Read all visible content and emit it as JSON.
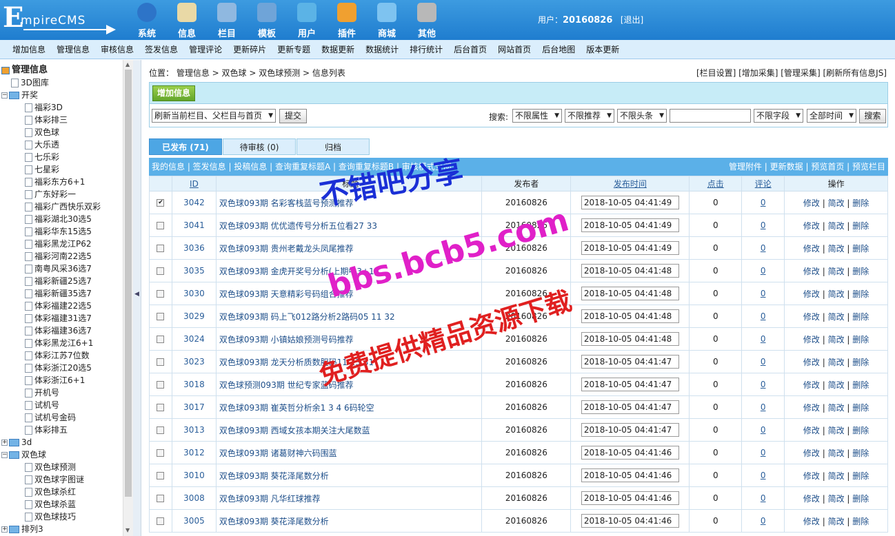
{
  "app": {
    "logo_first": "E",
    "logo_rest": "mpireCMS"
  },
  "mainmenu": [
    {
      "label": "系统",
      "icon": "globe-icon",
      "color": "#2d74c8"
    },
    {
      "label": "信息",
      "icon": "notepad-icon",
      "color": "#e9d9a6"
    },
    {
      "label": "栏目",
      "icon": "folder-icon",
      "color": "#8fb8e0"
    },
    {
      "label": "模板",
      "icon": "window-icon",
      "color": "#6fa4d8"
    },
    {
      "label": "用户",
      "icon": "user-icon",
      "color": "#5bb3e6"
    },
    {
      "label": "插件",
      "icon": "tools-icon",
      "color": "#f0a030"
    },
    {
      "label": "商城",
      "icon": "card-icon",
      "color": "#7ec3f0"
    },
    {
      "label": "其他",
      "icon": "gear-icon",
      "color": "#b8b8b8"
    }
  ],
  "user": {
    "prefix": "用户：",
    "name": "20160826",
    "logout": "[退出]"
  },
  "subnav": [
    "增加信息",
    "管理信息",
    "审核信息",
    "签发信息",
    "管理评论",
    "更新碎片",
    "更新专题",
    "数据更新",
    "数据统计",
    "排行统计",
    "后台首页",
    "网站首页",
    "后台地图",
    "版本更新"
  ],
  "tree": [
    {
      "label": "管理信息",
      "lvl": 0,
      "kind": "root"
    },
    {
      "label": "3D图库",
      "lvl": 1,
      "kind": "page"
    },
    {
      "label": "开奖",
      "lvl": 0,
      "kind": "folder",
      "open": true
    },
    {
      "label": "福彩3D",
      "lvl": 2,
      "kind": "page"
    },
    {
      "label": "体彩排三",
      "lvl": 2,
      "kind": "page"
    },
    {
      "label": "双色球",
      "lvl": 2,
      "kind": "page"
    },
    {
      "label": "大乐透",
      "lvl": 2,
      "kind": "page"
    },
    {
      "label": "七乐彩",
      "lvl": 2,
      "kind": "page"
    },
    {
      "label": "七星彩",
      "lvl": 2,
      "kind": "page"
    },
    {
      "label": "福彩东方6+1",
      "lvl": 2,
      "kind": "page"
    },
    {
      "label": "广东好彩一",
      "lvl": 2,
      "kind": "page"
    },
    {
      "label": "福彩广西快乐双彩",
      "lvl": 2,
      "kind": "page"
    },
    {
      "label": "福彩湖北30选5",
      "lvl": 2,
      "kind": "page"
    },
    {
      "label": "福彩华东15选5",
      "lvl": 2,
      "kind": "page"
    },
    {
      "label": "福彩黑龙江P62",
      "lvl": 2,
      "kind": "page"
    },
    {
      "label": "福彩河南22选5",
      "lvl": 2,
      "kind": "page"
    },
    {
      "label": "南粤风采36选7",
      "lvl": 2,
      "kind": "page"
    },
    {
      "label": "福彩新疆25选7",
      "lvl": 2,
      "kind": "page"
    },
    {
      "label": "福彩新疆35选7",
      "lvl": 2,
      "kind": "page"
    },
    {
      "label": "体彩福建22选5",
      "lvl": 2,
      "kind": "page"
    },
    {
      "label": "体彩福建31选7",
      "lvl": 2,
      "kind": "page"
    },
    {
      "label": "体彩福建36选7",
      "lvl": 2,
      "kind": "page"
    },
    {
      "label": "体彩黑龙江6+1",
      "lvl": 2,
      "kind": "page"
    },
    {
      "label": "体彩江苏7位数",
      "lvl": 2,
      "kind": "page"
    },
    {
      "label": "体彩浙江20选5",
      "lvl": 2,
      "kind": "page"
    },
    {
      "label": "体彩浙江6+1",
      "lvl": 2,
      "kind": "page"
    },
    {
      "label": "开机号",
      "lvl": 2,
      "kind": "page"
    },
    {
      "label": "试机号",
      "lvl": 2,
      "kind": "page"
    },
    {
      "label": "试机号金码",
      "lvl": 2,
      "kind": "page"
    },
    {
      "label": "体彩排五",
      "lvl": 2,
      "kind": "page"
    },
    {
      "label": "3d",
      "lvl": 0,
      "kind": "folder",
      "open": false
    },
    {
      "label": "双色球",
      "lvl": 0,
      "kind": "folder",
      "open": true
    },
    {
      "label": "双色球预测",
      "lvl": 2,
      "kind": "page"
    },
    {
      "label": "双色球字图谜",
      "lvl": 2,
      "kind": "page"
    },
    {
      "label": "双色球杀红",
      "lvl": 2,
      "kind": "page"
    },
    {
      "label": "双色球杀蓝",
      "lvl": 2,
      "kind": "page"
    },
    {
      "label": "双色球技巧",
      "lvl": 2,
      "kind": "page"
    },
    {
      "label": "排列3",
      "lvl": 0,
      "kind": "folder",
      "open": false
    }
  ],
  "location": {
    "prefix": "位置：",
    "path": "管理信息 > 双色球 > 双色球预测 > 信息列表"
  },
  "loc_links": "[栏目设置] [增加采集] [管理采集] [刷新所有信息JS]",
  "add_button": "增加信息",
  "toolbar": {
    "refresh": "刷新当前栏目、父栏目与首页",
    "submit": "提交",
    "search_label": "搜索:",
    "f1": "不限属性",
    "f2": "不限推荐",
    "f3": "不限头条",
    "f4": "不限字段",
    "f5": "全部时间",
    "search_btn": "搜索"
  },
  "tabs": [
    "已发布 (71)",
    "待审核 (0)",
    "归档"
  ],
  "linkbar": {
    "left": "我的信息 | 签发信息 | 投稿信息 | 查询重复标题A | 查询重复标题B | 审核模式全部",
    "right": "管理附件 | 更新数据 | 预览首页 | 预览栏目"
  },
  "columns": {
    "id": "ID",
    "title": "标题",
    "author": "发布者",
    "time": "发布时间",
    "clicks": "点击",
    "comments": "评论",
    "ops": "操作"
  },
  "ops": {
    "edit": "修改",
    "simple": "简改",
    "del": "删除"
  },
  "rows": [
    {
      "id": "3042",
      "title": "双色球093期 名彩客栈蓝号预测推荐",
      "author": "20160826",
      "time": "2018-10-05 04:41:49",
      "clicks": "0",
      "comments": "0",
      "checked": true
    },
    {
      "id": "3041",
      "title": "双色球093期 优优遗传号分析五位看27 33",
      "author": "20160826",
      "time": "2018-10-05 04:41:49",
      "clicks": "0",
      "comments": "0",
      "checked": false
    },
    {
      "id": "3036",
      "title": "双色球093期 贵州老戴龙头凤尾推荐",
      "author": "20160826",
      "time": "2018-10-05 04:41:49",
      "clicks": "0",
      "comments": "0",
      "checked": false
    },
    {
      "id": "3035",
      "title": "双色球093期 金虎开奖号分析(上期中3+1)",
      "author": "20160826",
      "time": "2018-10-05 04:41:48",
      "clicks": "0",
      "comments": "0",
      "checked": false
    },
    {
      "id": "3030",
      "title": "双色球093期 天意精彩号码组合推荐",
      "author": "20160826",
      "time": "2018-10-05 04:41:48",
      "clicks": "0",
      "comments": "0",
      "checked": false
    },
    {
      "id": "3029",
      "title": "双色球093期 码上飞012路分析2路码05 11 32",
      "author": "20160826",
      "time": "2018-10-05 04:41:48",
      "clicks": "0",
      "comments": "0",
      "checked": false
    },
    {
      "id": "3024",
      "title": "双色球093期 小镇姑娘预测号码推荐",
      "author": "20160826",
      "time": "2018-10-05 04:41:48",
      "clicks": "0",
      "comments": "0",
      "checked": false
    },
    {
      "id": "3023",
      "title": "双色球093期 龙天分析质数胆码11 23 31",
      "author": "20160826",
      "time": "2018-10-05 04:41:47",
      "clicks": "0",
      "comments": "0",
      "checked": false
    },
    {
      "id": "3018",
      "title": "双色球预测093期 世纪专家蓝码推荐",
      "author": "20160826",
      "time": "2018-10-05 04:41:47",
      "clicks": "0",
      "comments": "0",
      "checked": false
    },
    {
      "id": "3017",
      "title": "双色球093期 崔英哲分析余1 3 4 6码轮空",
      "author": "20160826",
      "time": "2018-10-05 04:41:47",
      "clicks": "0",
      "comments": "0",
      "checked": false
    },
    {
      "id": "3013",
      "title": "双色球093期 西域女孩本期关注大尾数蓝",
      "author": "20160826",
      "time": "2018-10-05 04:41:47",
      "clicks": "0",
      "comments": "0",
      "checked": false
    },
    {
      "id": "3012",
      "title": "双色球093期 诸葛财神六码围蓝",
      "author": "20160826",
      "time": "2018-10-05 04:41:46",
      "clicks": "0",
      "comments": "0",
      "checked": false
    },
    {
      "id": "3010",
      "title": "双色球093期 葵花泽尾数分析",
      "author": "20160826",
      "time": "2018-10-05 04:41:46",
      "clicks": "0",
      "comments": "0",
      "checked": false
    },
    {
      "id": "3008",
      "title": "双色球093期 凡华红球推荐",
      "author": "20160826",
      "time": "2018-10-05 04:41:46",
      "clicks": "0",
      "comments": "0",
      "checked": false
    },
    {
      "id": "3005",
      "title": "双色球093期 葵花泽尾数分析",
      "author": "20160826",
      "time": "2018-10-05 04:41:46",
      "clicks": "0",
      "comments": "0",
      "checked": false
    }
  ],
  "watermarks": [
    {
      "text": "不错吧分享",
      "color": "#1a2fd6"
    },
    {
      "text": "bbs.bcb5.com",
      "color": "#e020c8"
    },
    {
      "text": "免费提供精品资源下载",
      "color": "#e02020"
    }
  ]
}
